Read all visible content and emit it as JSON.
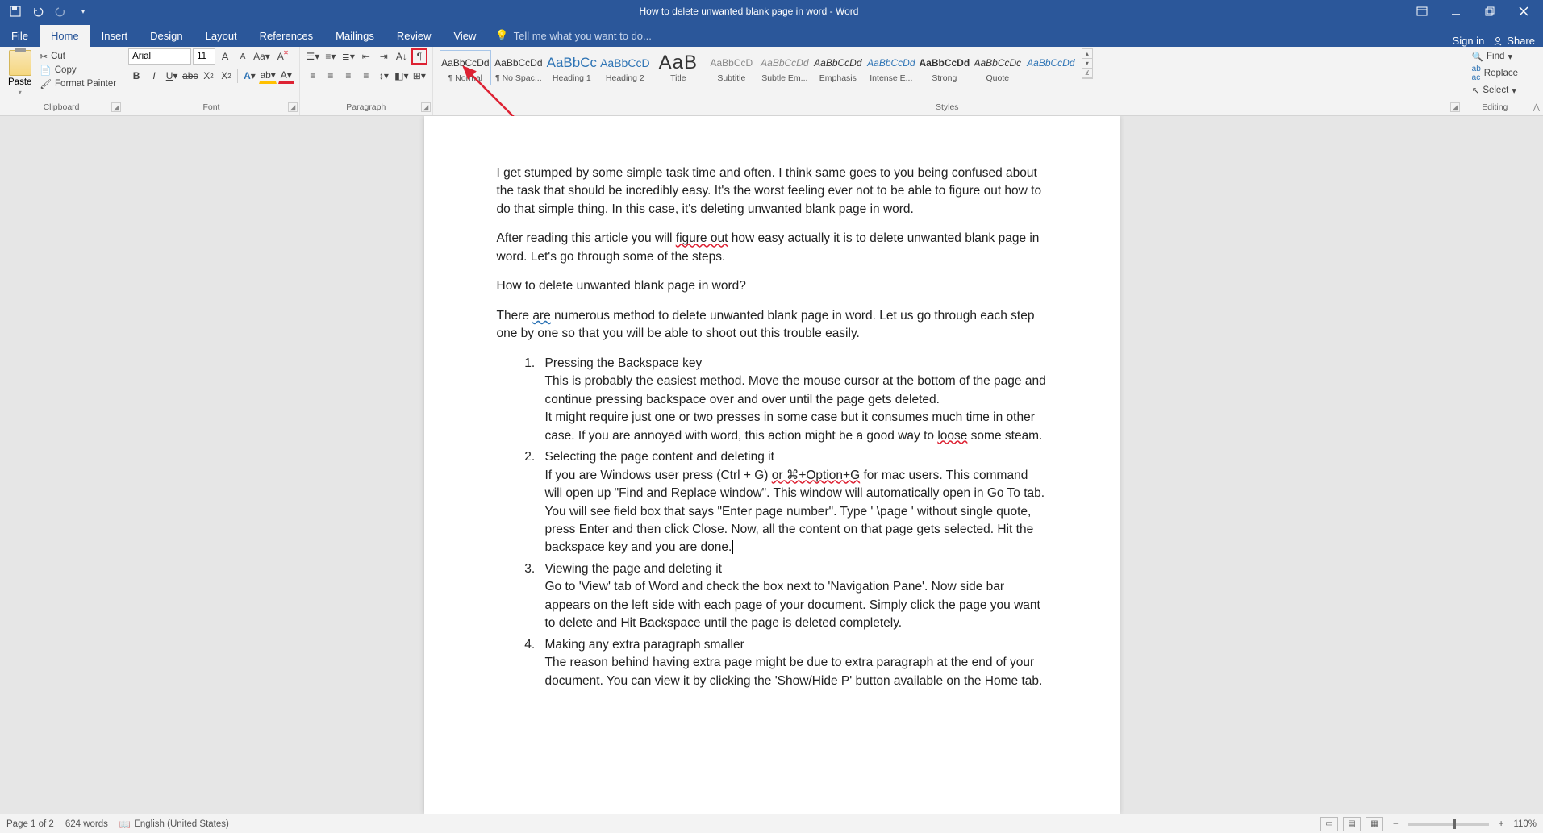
{
  "titlebar": {
    "title": "How to delete unwanted blank page in word - Word"
  },
  "menu": {
    "file": "File",
    "home": "Home",
    "insert": "Insert",
    "design": "Design",
    "layout": "Layout",
    "references": "References",
    "mailings": "Mailings",
    "review": "Review",
    "view": "View",
    "tell_me": "Tell me what you want to do...",
    "sign_in": "Sign in",
    "share": "Share"
  },
  "ribbon": {
    "clipboard": {
      "label": "Clipboard",
      "paste": "Paste",
      "cut": "Cut",
      "copy": "Copy",
      "format_painter": "Format Painter"
    },
    "font": {
      "label": "Font",
      "name": "Arial",
      "size": "11"
    },
    "paragraph": {
      "label": "Paragraph"
    },
    "styles": {
      "label": "Styles",
      "items": [
        {
          "preview": "AaBbCcDd",
          "name": "¶ Normal",
          "cls": ""
        },
        {
          "preview": "AaBbCcDd",
          "name": "¶ No Spac...",
          "cls": ""
        },
        {
          "preview": "AaBbCc",
          "name": "Heading 1",
          "cls": "h1"
        },
        {
          "preview": "AaBbCcD",
          "name": "Heading 2",
          "cls": "h2"
        },
        {
          "preview": "AaB",
          "name": "Title",
          "cls": "title"
        },
        {
          "preview": "AaBbCcD",
          "name": "Subtitle",
          "cls": "subt"
        },
        {
          "preview": "AaBbCcDd",
          "name": "Subtle Em...",
          "cls": "em subt"
        },
        {
          "preview": "AaBbCcDd",
          "name": "Emphasis",
          "cls": "em"
        },
        {
          "preview": "AaBbCcDd",
          "name": "Intense E...",
          "cls": "iem"
        },
        {
          "preview": "AaBbCcDd",
          "name": "Strong",
          "cls": "strong"
        },
        {
          "preview": "AaBbCcDc",
          "name": "Quote",
          "cls": "em"
        },
        {
          "preview": "AaBbCcDd",
          "name": "",
          "cls": "iref"
        }
      ]
    },
    "editing": {
      "label": "Editing",
      "find": "Find",
      "replace": "Replace",
      "select": "Select"
    }
  },
  "doc": {
    "p1": "I get stumped by some simple task time and often. I think same goes to you being confused about the task that should be incredibly easy. It's the worst feeling ever not to be able to figure out how to do that simple thing. In this case, it's deleting unwanted blank page in word.",
    "p2a": "After reading this article you will ",
    "p2b": "figure  out",
    "p2c": " how easy actually it is to delete unwanted blank page in word. Let's go through some of the steps.",
    "p3": "How to delete unwanted blank page in word?",
    "p4a": "There ",
    "p4b": "are",
    "p4c": " numerous method to delete unwanted blank page in word. Let us go through each step one by one so that you will be able to shoot out this trouble easily.",
    "li1_title": "Pressing the Backspace key",
    "li1_b1": "This is probably the easiest method. Move the mouse cursor at the bottom of the page and continue pressing backspace over and over until the page gets deleted.",
    "li1_b2a": "It might require just one or two presses in some case but it consumes much time in other case. If you are annoyed with word, this action might be a good way to ",
    "li1_b2b": "loose",
    "li1_b2c": " some steam.",
    "li2_title": "Selecting the page content and deleting it",
    "li2_b1a": "If you are Windows user press (Ctrl + G) ",
    "li2_b1b": "or  ⌘+Option+G",
    "li2_b1c": "  for mac users. This command will open up \"Find and Replace window\". This window will automatically open in Go To tab. You will see field box that says \"Enter page number\". Type ' \\page ' without single quote, press Enter and then click Close. Now, all the content on that page gets selected. Hit the backspace key and you are done.",
    "li3_title": "Viewing the page and deleting it",
    "li3_b1": "Go to 'View' tab of Word and check the box next to 'Navigation Pane'. Now side bar appears on the left side with each page of your document. Simply click the page you want to delete and Hit Backspace until the page is deleted completely.",
    "li4_title": "Making any extra paragraph smaller",
    "li4_b1": "The reason behind having extra page might be due to extra paragraph at the end of your document. You can view it by clicking the 'Show/Hide P' button available on the Home tab."
  },
  "status": {
    "page": "Page 1 of 2",
    "words": "624 words",
    "lang": "English (United States)",
    "zoom": "110%"
  }
}
